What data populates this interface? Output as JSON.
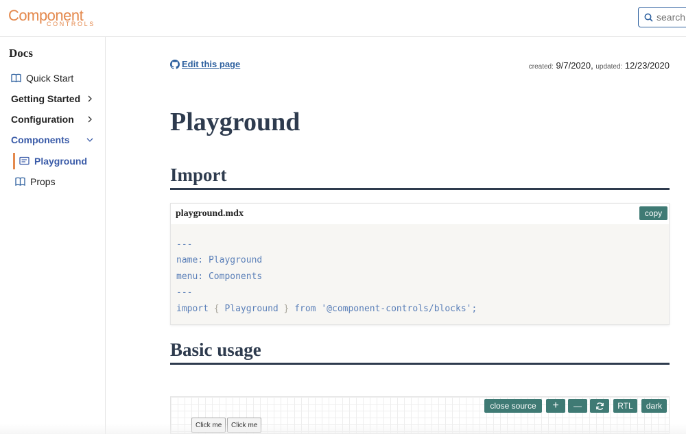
{
  "header": {
    "logo_main": "Component",
    "logo_sub": "CONTROLS",
    "search_placeholder": "search"
  },
  "sidebar": {
    "title": "Docs",
    "items": [
      {
        "label": "Quick Start",
        "icon": "book-icon"
      },
      {
        "label": "Getting Started",
        "icon": "chevron-right-icon"
      },
      {
        "label": "Configuration",
        "icon": "chevron-right-icon"
      },
      {
        "label": "Components",
        "icon": "chevron-down-icon"
      },
      {
        "label": "Playground",
        "icon": "page-icon",
        "active": true
      },
      {
        "label": "Props",
        "icon": "book-icon"
      }
    ]
  },
  "main": {
    "edit_link": "Edit this page",
    "created_label": "created:",
    "created_date": "9/7/2020,",
    "updated_label": "updated:",
    "updated_date": "12/23/2020",
    "title": "Playground",
    "section_import": "Import",
    "section_basic": "Basic usage",
    "code": {
      "filename": "playground.mdx",
      "copy_label": "copy",
      "lines": [
        {
          "a": "---"
        },
        {
          "a": "name: Playground"
        },
        {
          "a": "menu: Components"
        },
        {
          "a": "---"
        },
        {
          "a": "import ",
          "b": "{",
          "c": " Playground ",
          "d": "}",
          "e": " from '@component-controls/blocks';"
        }
      ]
    },
    "playground": {
      "close_source": "close source",
      "zoom_in": "+",
      "zoom_out": "—",
      "rtl": "RTL",
      "dark": "dark",
      "button_1": "Click me",
      "button_2": "Click me"
    }
  },
  "colors": {
    "accent": "#e4894d",
    "link": "#2c5f9e",
    "button": "#3f7a74",
    "heading": "#2e3b4e"
  }
}
